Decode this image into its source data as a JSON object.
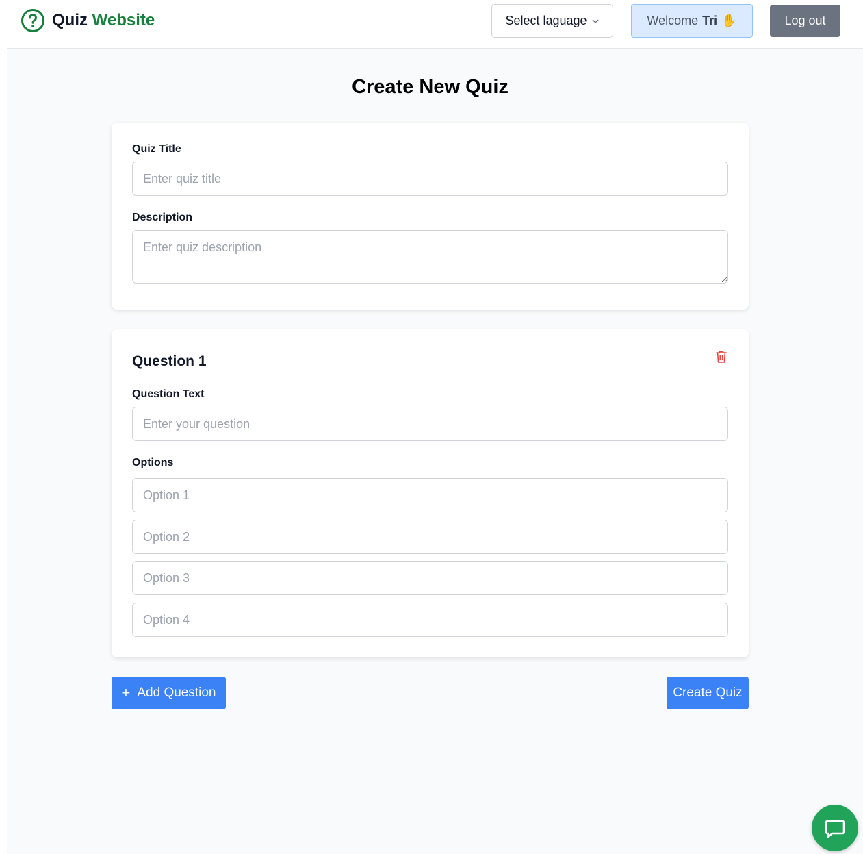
{
  "header": {
    "logo_primary": "Quiz",
    "logo_accent": "Website",
    "language_label": "Select laguage",
    "welcome_prefix": "Welcome",
    "welcome_name": "Tri",
    "welcome_emoji": "✋",
    "logout_label": "Log out"
  },
  "page": {
    "title": "Create New Quiz"
  },
  "quiz_form": {
    "title_label": "Quiz Title",
    "title_placeholder": "Enter quiz title",
    "description_label": "Description",
    "description_placeholder": "Enter quiz description"
  },
  "questions": [
    {
      "heading": "Question 1",
      "text_label": "Question Text",
      "text_placeholder": "Enter your question",
      "options_label": "Options",
      "options": [
        "Option 1",
        "Option 2",
        "Option 3",
        "Option 4"
      ]
    }
  ],
  "actions": {
    "add_question_label": "Add Question",
    "create_quiz_label": "Create Quiz"
  },
  "colors": {
    "brand_green": "#16803c",
    "primary_blue": "#3b82f6",
    "danger_red": "#ef4444",
    "chat_green": "#22a35a"
  },
  "icons": [
    "question-circle-icon",
    "chevron-down-icon",
    "trash-icon",
    "plus-icon",
    "chat-icon"
  ]
}
